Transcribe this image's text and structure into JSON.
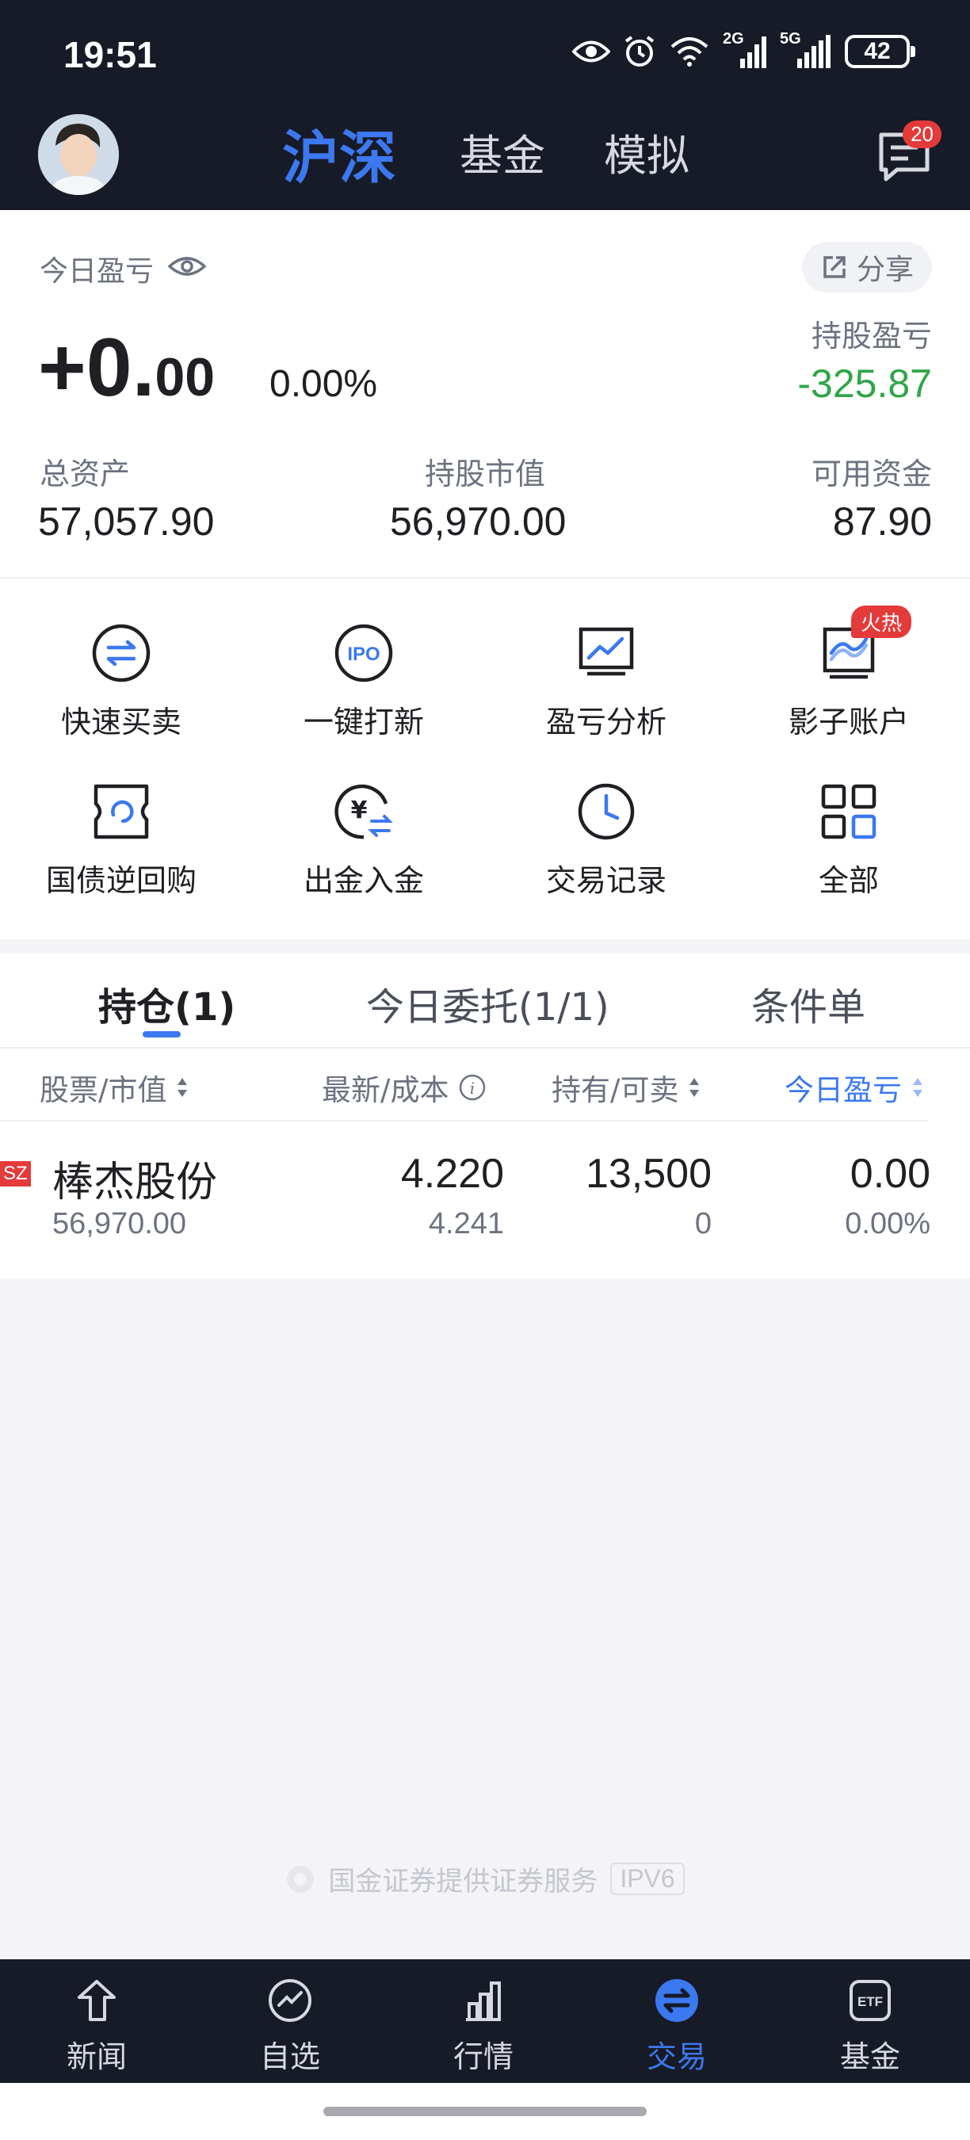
{
  "status_bar": {
    "time": "19:51",
    "network_2g": "2G",
    "network_5g": "5G",
    "battery": "42",
    "icons": [
      "eye-icon",
      "alarm-icon",
      "wifi-icon",
      "signal-2g-icon",
      "signal-5g-icon",
      "battery-icon"
    ]
  },
  "header": {
    "tabs": [
      {
        "label": "沪深",
        "active": true
      },
      {
        "label": "基金",
        "active": false
      },
      {
        "label": "模拟",
        "active": false
      }
    ],
    "message_badge": "20"
  },
  "account": {
    "today_pl_label": "今日盈亏",
    "share_label": "分享",
    "today_pl_int": "+0.",
    "today_pl_dec": "00",
    "today_pl_pct": "0.00%",
    "holding_pl_label": "持股盈亏",
    "holding_pl_value": "-325.87",
    "stats": [
      {
        "label": "总资产",
        "value": "57,057.90"
      },
      {
        "label": "持股市值",
        "value": "56,970.00"
      },
      {
        "label": "可用资金",
        "value": "87.90"
      }
    ]
  },
  "quick_menu": {
    "items": [
      {
        "label": "快速买卖",
        "icon": "swap-icon"
      },
      {
        "label": "一键打新",
        "icon": "ipo-icon"
      },
      {
        "label": "盈亏分析",
        "icon": "chart-analysis-icon"
      },
      {
        "label": "影子账户",
        "icon": "shadow-account-icon"
      },
      {
        "label": "国债逆回购",
        "icon": "bond-repo-icon"
      },
      {
        "label": "出金入金",
        "icon": "money-transfer-icon"
      },
      {
        "label": "交易记录",
        "icon": "clock-icon"
      },
      {
        "label": "全部",
        "icon": "grid-icon"
      }
    ],
    "hot_badge": "火热"
  },
  "positions": {
    "tabs": [
      {
        "label": "持仓(1)",
        "active": true
      },
      {
        "label": "今日委托(1/1)",
        "active": false
      },
      {
        "label": "条件单",
        "active": false
      }
    ],
    "columns": [
      "股票/市值",
      "最新/成本",
      "持有/可卖",
      "今日盈亏"
    ],
    "rows": [
      {
        "market": "SZ",
        "name": "棒杰股份",
        "market_value": "56,970.00",
        "latest": "4.220",
        "cost": "4.241",
        "holding": "13,500",
        "sellable": "0",
        "today_pl": "0.00",
        "today_pl_pct": "0.00%"
      }
    ]
  },
  "footer": {
    "provider": "国金证券提供证券服务",
    "ipv6": "IPV6"
  },
  "bottom_nav": {
    "items": [
      {
        "label": "新闻",
        "icon": "news-icon",
        "active": false
      },
      {
        "label": "自选",
        "icon": "watchlist-icon",
        "active": false
      },
      {
        "label": "行情",
        "icon": "market-icon",
        "active": false
      },
      {
        "label": "交易",
        "icon": "trade-icon",
        "active": true
      },
      {
        "label": "基金",
        "icon": "etf-icon",
        "active": false
      }
    ]
  },
  "colors": {
    "accent": "#3c78f0",
    "dark_bg": "#161b27",
    "loss_green": "#2fa648",
    "badge_red": "#e43a3a"
  }
}
